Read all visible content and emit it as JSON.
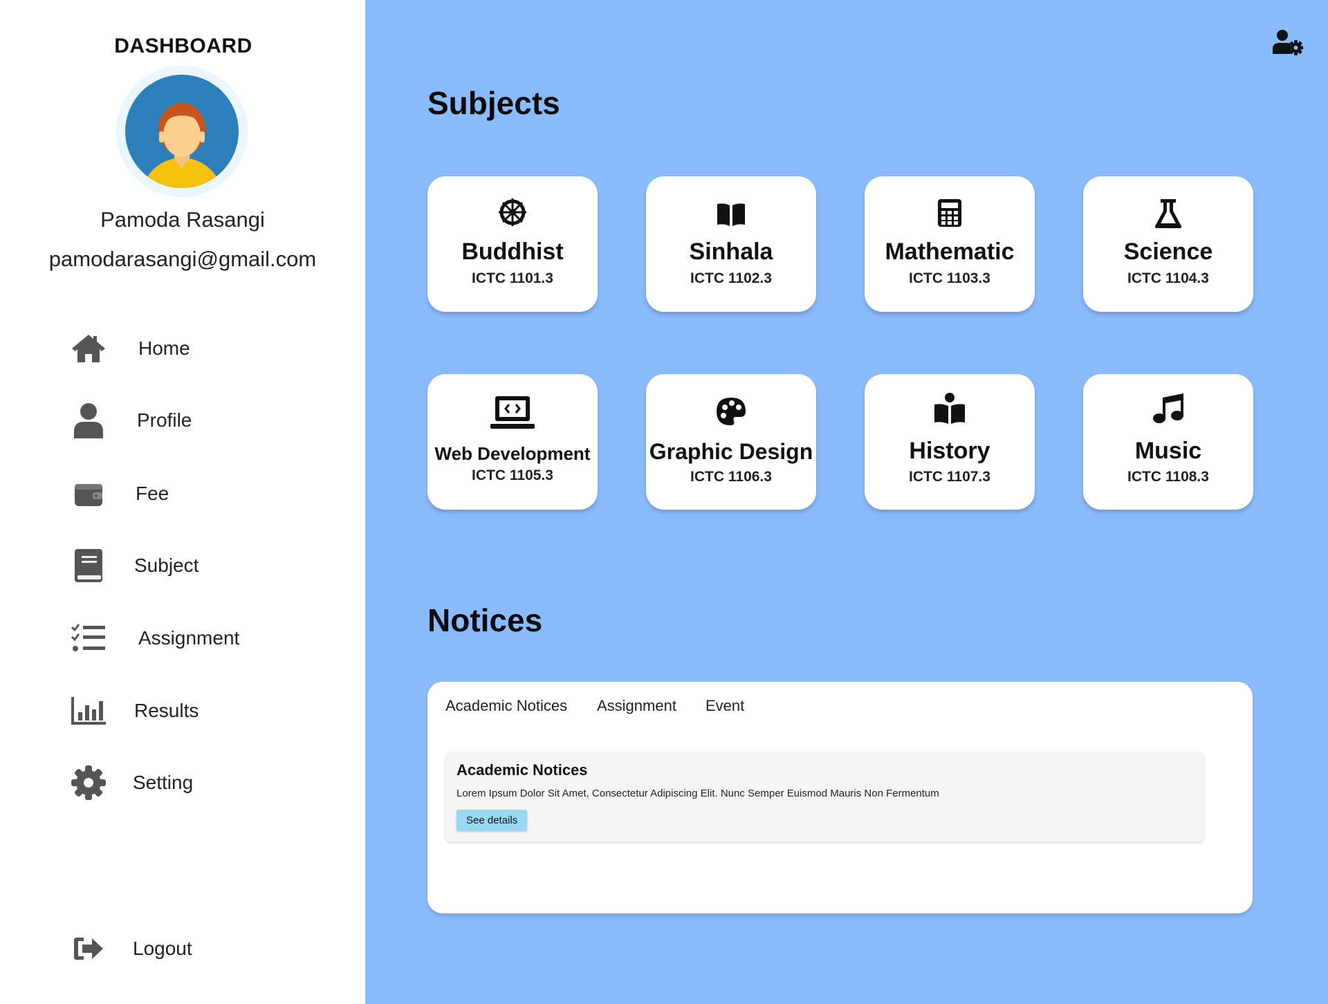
{
  "sidebar": {
    "title": "DASHBOARD",
    "user": {
      "name": "Pamoda Rasangi",
      "email": "pamodarasangi@gmail.com"
    },
    "nav": [
      {
        "label": "Home",
        "icon": "home-icon"
      },
      {
        "label": "Profile",
        "icon": "user-icon"
      },
      {
        "label": "Fee",
        "icon": "wallet-icon"
      },
      {
        "label": "Subject",
        "icon": "book-icon"
      },
      {
        "label": "Assignment",
        "icon": "checklist-icon"
      },
      {
        "label": "Results",
        "icon": "bar-chart-icon"
      },
      {
        "label": "Setting",
        "icon": "gear-icon"
      }
    ],
    "logout": {
      "label": "Logout",
      "icon": "logout-icon"
    }
  },
  "main": {
    "subjects_title": "Subjects",
    "subjects": [
      {
        "name": "Buddhist",
        "code": "ICTC 1101.3",
        "icon": "dharma-wheel-icon"
      },
      {
        "name": "Sinhala",
        "code": "ICTC 1102.3",
        "icon": "open-book-icon"
      },
      {
        "name": "Mathematic",
        "code": "ICTC 1103.3",
        "icon": "calculator-icon"
      },
      {
        "name": "Science",
        "code": "ICTC 1104.3",
        "icon": "flask-icon"
      },
      {
        "name": "Web Development",
        "code": "ICTC 1105.3",
        "icon": "laptop-code-icon"
      },
      {
        "name": "Graphic Design",
        "code": "ICTC 1106.3",
        "icon": "palette-icon"
      },
      {
        "name": "History",
        "code": "ICTC 1107.3",
        "icon": "book-reader-icon"
      },
      {
        "name": "Music",
        "code": "ICTC 1108.3",
        "icon": "music-note-icon"
      }
    ],
    "notices_title": "Notices",
    "notices": {
      "tabs": [
        "Academic Notices",
        "Assignment",
        "Event"
      ],
      "card": {
        "title": "Academic Notices",
        "body": "Lorem Ipsum Dolor Sit Amet, Consectetur Adipiscing Elit. Nunc Semper Euismod Mauris Non Fermentum",
        "button": "See details"
      }
    }
  },
  "colors": {
    "main_bg": "#8abbfd",
    "sidebar_bg": "#ffffff",
    "icon_gray": "#555555",
    "button_bg": "#96d9f2"
  }
}
